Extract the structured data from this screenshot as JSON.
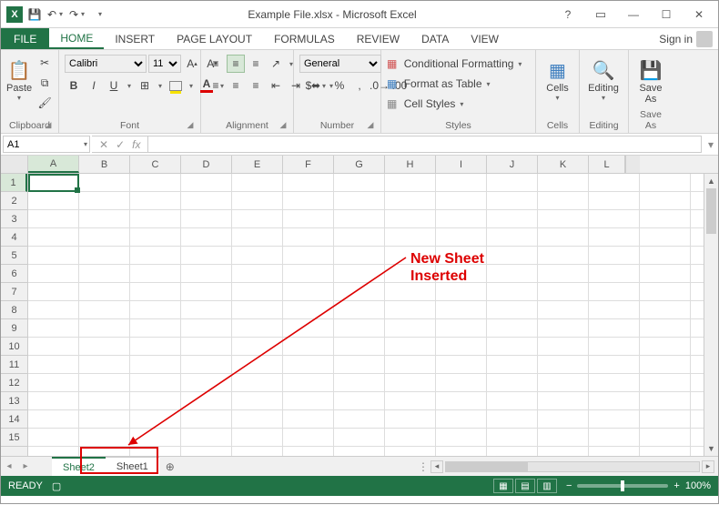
{
  "title": "Example File.xlsx - Microsoft Excel",
  "qat": {
    "save": "💾",
    "undo": "↶",
    "redo": "↷"
  },
  "tabs": {
    "file": "FILE",
    "home": "HOME",
    "insert": "INSERT",
    "page": "PAGE LAYOUT",
    "formulas": "FORMULAS",
    "review": "REVIEW",
    "data": "DATA",
    "view": "VIEW",
    "signin": "Sign in"
  },
  "ribbon": {
    "clipboard": {
      "label": "Clipboard",
      "paste": "Paste"
    },
    "font": {
      "label": "Font",
      "name": "Calibri",
      "size": "11",
      "bold": "B",
      "italic": "I",
      "underline": "U"
    },
    "alignment": {
      "label": "Alignment"
    },
    "number": {
      "label": "Number",
      "format": "General",
      "dollar": "$",
      "percent": "%",
      "comma": ",",
      "incdec": "⁰₀",
      "decdec": "₀⁰"
    },
    "styles": {
      "label": "Styles",
      "cond": "Conditional Formatting",
      "table": "Format as Table",
      "cell": "Cell Styles"
    },
    "cells": {
      "label": "Cells",
      "btn": "Cells"
    },
    "editing": {
      "label": "Editing",
      "btn": "Editing"
    },
    "saveas": {
      "label": "Save As",
      "btn": "Save\nAs"
    }
  },
  "namebox": "A1",
  "fx": "fx",
  "columns": [
    "A",
    "B",
    "C",
    "D",
    "E",
    "F",
    "G",
    "H",
    "I",
    "J",
    "K",
    "L"
  ],
  "rows": [
    "1",
    "2",
    "3",
    "4",
    "5",
    "6",
    "7",
    "8",
    "9",
    "10",
    "11",
    "12",
    "13",
    "14",
    "15"
  ],
  "sheets": {
    "active": "Sheet2",
    "other": "Sheet1",
    "new": "⊕"
  },
  "status": {
    "ready": "READY",
    "zoom": "100%",
    "minus": "−",
    "plus": "+"
  },
  "annot": {
    "l1": "New Sheet",
    "l2": "Inserted"
  }
}
